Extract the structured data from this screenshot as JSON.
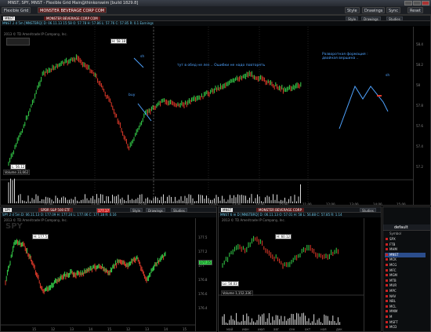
{
  "window": {
    "title": "MNST, SPY, MNST - Flexible Grid Main@thinkorswim [build 1829.8]",
    "menu": {
      "flexible_grid": "Flexible Grid",
      "ticker_banner": "MONSTER BEVERAGE CORP COM",
      "style": "Style",
      "drawings": "Drawings",
      "studies": "Studies",
      "cog": "Sync",
      "reset": "Reset"
    }
  },
  "main_chart": {
    "symbol": "MNST",
    "company": "MONSTER BEVERAGE CORP COM",
    "info_line": "MNST 2 d 5m [MNSTBRQ]  D: 06.11.13 15:58  O: 57.78  H: 57.86  L: 57.76  C: 57.85  R: 0.1  Earnings",
    "copyright": "2013 © TD Ameritrade IP Company, Inc.",
    "high_label": "H: 58.18",
    "low_label": "L: 56.12",
    "annotations": {
      "sh1": "sh",
      "buy": "buy",
      "comment": "тут в обед не лез .. Ошибки не надо повторять",
      "formation": "Разворотная формация : двойная вершина ..",
      "sh2": "sh"
    },
    "volume_label": "Volume  33,662",
    "x_ticks": [
      "11:00",
      "12:00",
      "13:00",
      "14:00",
      "15:00",
      "7",
      "11:00",
      "12:00",
      "13:00",
      "14:00",
      "15:00",
      "11:00",
      "12:00",
      "13:00",
      "14:00",
      "15:00"
    ],
    "y_ticks": [
      "58.4",
      "58.2",
      "58",
      "57.8",
      "57.6",
      "57.4",
      "57.2"
    ]
  },
  "spy_chart": {
    "symbol": "SPY",
    "company": "SPDR S&P 500 ETF",
    "info_line": "SPY 2 d 5m  D: 06.11.13  O: 177.09  H: 177.24  L: 177.06  C: 177.18  R: 0.16",
    "copyright": "2013 © TD Ameritrade IP Company, Inc.",
    "high_label": "H: 177.5",
    "last_price": "177.15",
    "price_tag": "177.17",
    "x_ticks": [
      "15",
      "12",
      "13",
      "14",
      "15",
      "12",
      "13",
      "14",
      "15"
    ],
    "y_ticks": [
      "177.5",
      "177.2",
      "177",
      "176.8",
      "176.6",
      "176.4"
    ]
  },
  "mnst_small_chart": {
    "symbol": "MNST",
    "company": "MONSTER BEVERAGE CORP",
    "info_line": "MNST 6 m D [MNSTBRQ]  D: 06.11.13  O: 57.01  H: 58  L: 56.88  C: 57.85  R: 1.14",
    "copyright": "2013 © TD Ameritrade IP Company, Inc.",
    "high_label": "H: 60.12",
    "low_label": "Lo: 50.03",
    "volume_label": "Volume  1,152,336",
    "x_ticks": [
      "май",
      "июн",
      "июл",
      "авг",
      "сен",
      "окт",
      "ноя",
      "дек"
    ]
  },
  "watchlist": {
    "name": "default",
    "header": "Symbol",
    "symbols": [
      "SPX",
      "FTB",
      "MHM",
      "MNST",
      "MCK",
      "MCG",
      "MFC",
      "MGM",
      "MTB",
      "MUR",
      "MPC",
      "NAV",
      "NBL",
      "MCL",
      "MMM",
      "M",
      "MSFT",
      "MCD"
    ],
    "selected": "MNST"
  },
  "colors": {
    "up_bar": "#35d14a",
    "down_bar": "#e23a2a",
    "annotation": "#4fa3ff",
    "axis_text": "#888888",
    "background": "#000000"
  }
}
